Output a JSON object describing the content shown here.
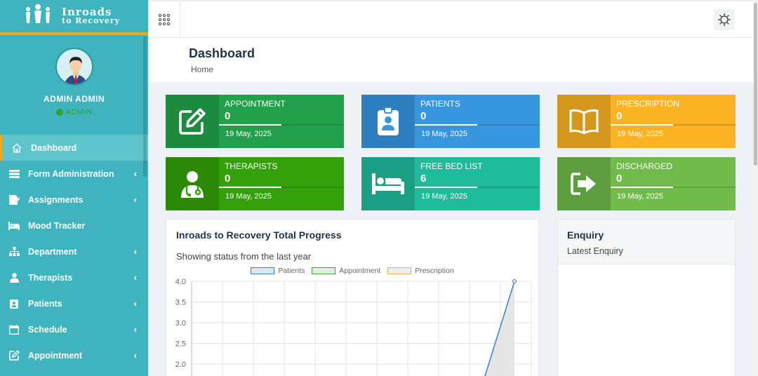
{
  "brand": {
    "line1": "Inroads",
    "line2": "to Recovery"
  },
  "profile": {
    "name": "ADMIN ADMIN",
    "role": "ADMIN"
  },
  "menu": [
    {
      "label": "Dashboard",
      "icon": "home-icon",
      "chevron": false,
      "active": true
    },
    {
      "label": "Form Administration",
      "icon": "form-icon",
      "chevron": true
    },
    {
      "label": "Assignments",
      "icon": "pencil-icon",
      "chevron": true
    },
    {
      "label": "Mood Tracker",
      "icon": "bed-icon",
      "chevron": false
    },
    {
      "label": "Department",
      "icon": "sitemap-icon",
      "chevron": true
    },
    {
      "label": "Therapists",
      "icon": "user-md-icon",
      "chevron": true
    },
    {
      "label": "Patients",
      "icon": "badge-icon",
      "chevron": true
    },
    {
      "label": "Schedule",
      "icon": "calendar-icon",
      "chevron": true
    },
    {
      "label": "Appointment",
      "icon": "edit-icon",
      "chevron": true
    }
  ],
  "header": {
    "title": "Dashboard",
    "breadcrumb": "Home"
  },
  "cards": [
    {
      "label": "APPOINTMENT",
      "value": "0",
      "date": "19 May, 2025",
      "icon": "edit-icon",
      "color": "#22a04b",
      "dark": "#1c8a3f"
    },
    {
      "label": "PATIENTS",
      "value": "0",
      "date": "19 May, 2025",
      "icon": "id-badge-icon",
      "color": "#3796dd",
      "dark": "#2e7fbf"
    },
    {
      "label": "PRESCRIPTION",
      "value": "0",
      "date": "19 May, 2025",
      "icon": "book-icon",
      "color": "#fbb324",
      "dark": "#d4981f"
    },
    {
      "label": "THERAPISTS",
      "value": "0",
      "date": "19 May, 2025",
      "icon": "user-md-icon",
      "color": "#34a10a",
      "dark": "#2c8a08"
    },
    {
      "label": "FREE BED LIST",
      "value": "6",
      "date": "19 May, 2025",
      "icon": "bed-icon",
      "color": "#1fbc9c",
      "dark": "#1a9f85"
    },
    {
      "label": "DISCHARGED",
      "value": "0",
      "date": "19 May, 2025",
      "icon": "sign-out-icon",
      "color": "#71bb4a",
      "dark": "#5f9e3e"
    }
  ],
  "progress": {
    "title": "Inroads to Recovery Total Progress",
    "subtitle": "Showing status from the last year"
  },
  "enquiry": {
    "title": "Enquiry",
    "subtitle": "Latest Enquiry"
  },
  "chart_data": {
    "type": "line",
    "title": "",
    "xlabel": "",
    "ylabel": "",
    "y_ticks": [
      "4.0",
      "3.5",
      "3.0",
      "2.5",
      "2.0"
    ],
    "ylim": [
      2.0,
      4.0
    ],
    "grid": true,
    "legend_position": "top",
    "series": [
      {
        "name": "Patients",
        "color": "#3b82c4",
        "fill": "#dde5ee",
        "x_index": [
          10,
          11
        ],
        "values": [
          1.6,
          4.0
        ]
      },
      {
        "name": "Appointment",
        "color": "#3fa43f",
        "fill": "#e3eede",
        "values": []
      },
      {
        "name": "Prescription",
        "color": "#f0b24a",
        "fill": "#eeeeee",
        "values": []
      }
    ],
    "x_count": 12
  }
}
